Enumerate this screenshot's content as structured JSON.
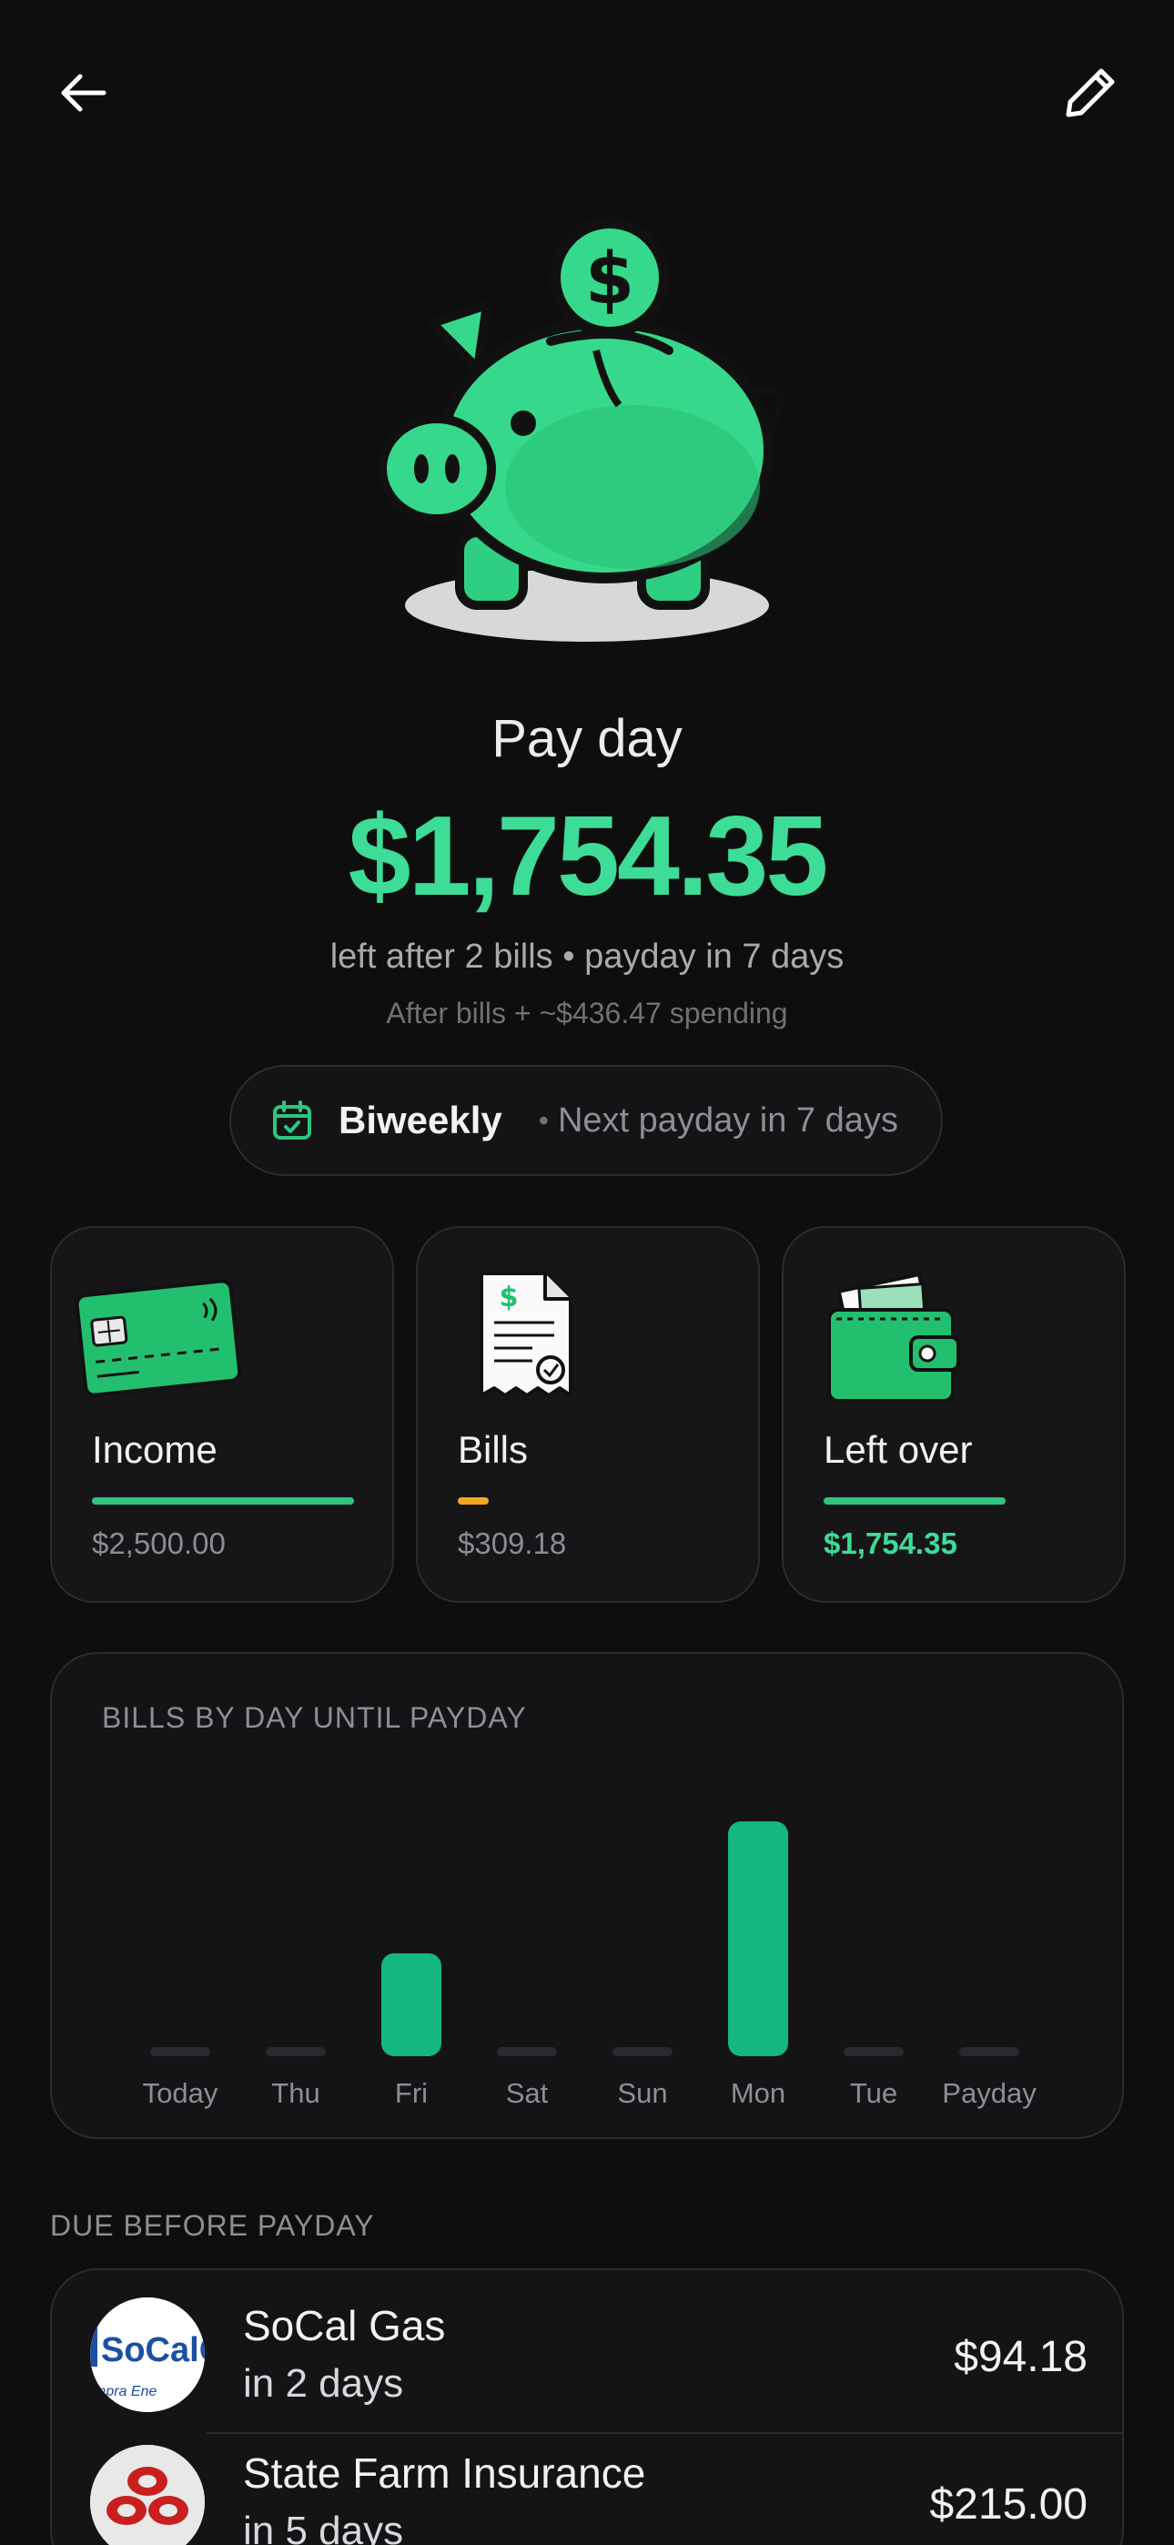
{
  "header": {
    "back_icon": "arrow-left-icon",
    "edit_icon": "pencil-icon"
  },
  "hero": {
    "illustration": "piggy-bank-icon",
    "title": "Pay day",
    "amount": "$1,754.35",
    "subtitle": "left after 2 bills • payday in 7 days",
    "note": "After bills + ~$436.47 spending"
  },
  "frequency": {
    "icon": "calendar-check-icon",
    "label": "Biweekly",
    "separator": "•",
    "next": "Next payday in 7 days"
  },
  "summary": [
    {
      "label": "Income",
      "value": "$2,500.00",
      "icon": "credit-card-icon",
      "fraction": 1.0,
      "color": "#2fc57f"
    },
    {
      "label": "Bills",
      "value": "$309.18",
      "icon": "receipt-icon",
      "fraction": 0.12,
      "color": "#f5a623"
    },
    {
      "label": "Left over",
      "value": "$1,754.35",
      "icon": "wallet-icon",
      "fraction": 0.7,
      "color": "#2fc57f"
    }
  ],
  "chart_data": {
    "type": "bar",
    "title": "BILLS BY DAY UNTIL PAYDAY",
    "categories": [
      "Today",
      "Thu",
      "Fri",
      "Sat",
      "Sun",
      "Mon",
      "Tue",
      "Payday"
    ],
    "values": [
      0,
      0,
      94.18,
      0,
      0,
      215.0,
      0,
      0
    ],
    "ylim": [
      0,
      215
    ],
    "grid": false,
    "bar_color": "#14b77e",
    "empty_color": "#2a2a2e"
  },
  "due": {
    "title": "DUE BEFORE PAYDAY",
    "items": [
      {
        "name": "SoCal Gas",
        "when": "in 2 days",
        "amount": "$94.18",
        "logo_text": "SoCalG",
        "logo_sub": "mpra Ene"
      },
      {
        "name": "State Farm Insurance",
        "when": "in 5 days",
        "amount": "$215.00"
      }
    ]
  }
}
